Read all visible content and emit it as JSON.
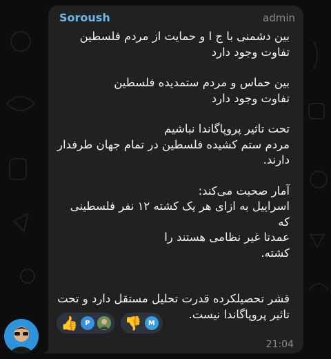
{
  "message": {
    "sender": "Soroush",
    "role": "admin",
    "paragraphs": [
      [
        "بین دشمنی با ج ا و حمایت از مردم فلسطین",
        "تفاوت وجود دارد"
      ],
      [
        "بین حماس و مردم ستمدیده فلسطین",
        "تفاوت وجود دارد"
      ],
      [
        "تحت تاثیر پروپاگاندا نباشیم",
        "مردم ستم کشیده فلسطین در تمام جهان طرفدار",
        "دارند."
      ],
      [
        "آمار صحبت می‌کند:",
        "اسراییل به ازای هر یک کشته ۱۲ نفر فلسطینی که",
        "عمدتا  غیر نظامی هستند را",
        "کشته."
      ],
      [
        "قشر تحصیلکرده قدرت تحلیل مستقل دارد و تحت",
        "تاثیر پروپاگاندا نیست."
      ]
    ],
    "time": "21:04"
  },
  "reactions": [
    {
      "emoji": "👍",
      "avatars": [
        {
          "initial": "P",
          "color": "#3a8fe0"
        },
        {
          "initial": "",
          "color": "#6b8f5a"
        }
      ]
    },
    {
      "emoji": "👎",
      "avatars": [
        {
          "initial": "M",
          "color": "#3a9fe0"
        }
      ]
    }
  ],
  "colors": {
    "sender": "#6cb8ea",
    "bubble": "#212121",
    "background": "#0d0d0d"
  }
}
